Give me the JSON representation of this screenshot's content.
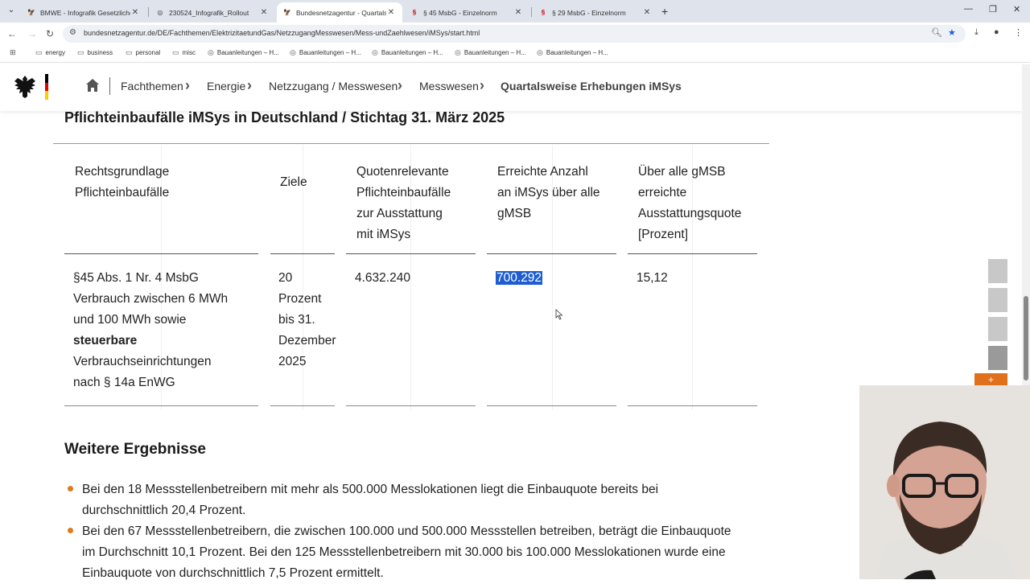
{
  "browser": {
    "tabs": [
      {
        "title": "BMWE - Infografik Gesetzlicher",
        "active": false
      },
      {
        "title": "230524_Infografik_Rollout",
        "active": false
      },
      {
        "title": "Bundesnetzagentur - Quartalsw",
        "active": true
      },
      {
        "title": "§ 45 MsbG - Einzelnorm",
        "active": false
      },
      {
        "title": "§ 29 MsbG - Einzelnorm",
        "active": false
      }
    ],
    "url": "bundesnetzagentur.de/DE/Fachthemen/ElektrizitaetundGas/NetzzugangMesswesen/Mess-undZaehlwesen/iMSys/start.html",
    "bookmarks": [
      "energy",
      "business",
      "personal",
      "misc",
      "Bauanleitungen – H...",
      "Bauanleitungen – H...",
      "Bauanleitungen – H...",
      "Bauanleitungen – H...",
      "Bauanleitungen – H..."
    ]
  },
  "breadcrumb": {
    "items": [
      "Fachthemen",
      "Energie",
      "Netzzugang / Messwesen",
      "Messwesen"
    ],
    "current": "Quartalsweise Erhebungen iMSys"
  },
  "table": {
    "title": "Pflichteinbaufälle iMSys in Deutschland / Stichtag 31. März 2025",
    "headers": [
      [
        "Rechtsgrundlage",
        "Pflichteinbaufälle"
      ],
      [
        "Ziele"
      ],
      [
        "Quotenrelevante",
        "Pflichteinbaufälle",
        "zur Ausstattung",
        "mit iMSys"
      ],
      [
        "Erreichte Anzahl",
        "an iMSys über alle",
        "gMSB"
      ],
      [
        "Über alle gMSB",
        "erreichte",
        "Ausstattungsquote",
        "[Prozent]"
      ]
    ],
    "row": {
      "law": [
        "§45 Abs. 1 Nr. 4 MsbG",
        "Verbrauch zwischen 6 MWh",
        "und 100 MWh sowie"
      ],
      "law_bold": "steuerbare",
      "law_rest": [
        "Verbrauchseinrichtungen",
        "nach § 14a EnWG"
      ],
      "goal": [
        "20",
        "Prozent",
        "bis 31.",
        "Dezember",
        "2025"
      ],
      "quota_relevant": "4.632.240",
      "achieved": "700.292",
      "rate": "15,12"
    }
  },
  "results": {
    "heading": "Weitere Ergebnisse",
    "bullets": [
      [
        "Bei den 18 Messstellenbetreibern mit mehr als 500.000 Messlokationen liegt die Einbauquote bereits bei",
        "durchschnittlich 20,4 Prozent."
      ],
      [
        "Bei den 67 Messstellenbetreibern, die zwischen 100.000 und 500.000 Messstellen betreiben, beträgt die Einbauquote",
        "im Durchschnitt 10,1 Prozent. Bei den 125 Messstellenbetreibern mit 30.000 bis 100.000 Messlokationen wurde eine",
        "Einbauquote von durchschnittlich 7,5 Prozent ermittelt."
      ]
    ]
  },
  "colors": {
    "accent": "#e07a1f",
    "selection": "#1d5dd1",
    "flag_black": "#000000",
    "flag_red": "#dd0000",
    "flag_gold": "#ffcc00"
  }
}
